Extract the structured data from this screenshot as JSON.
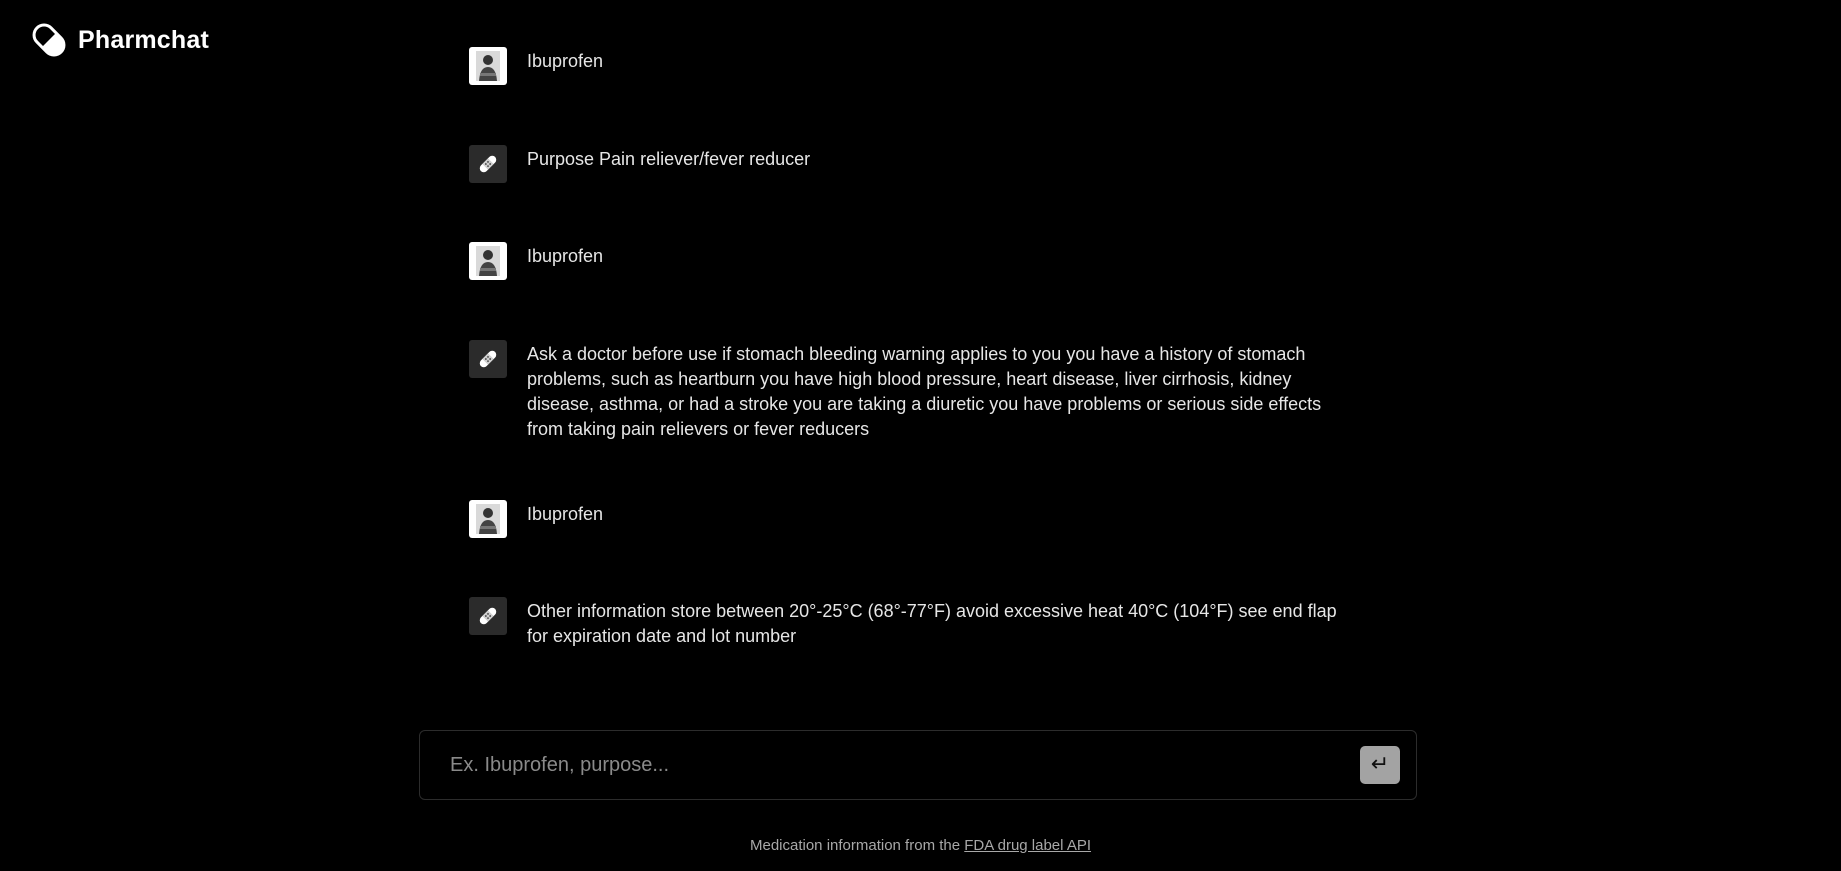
{
  "app": {
    "name": "Pharmchat",
    "logo_icon": "pill-icon"
  },
  "messages": [
    {
      "role": "user",
      "icon": "user-avatar",
      "text": "Ibuprofen"
    },
    {
      "role": "assistant",
      "icon": "bandage-icon",
      "text": "Purpose Pain reliever/fever reducer"
    },
    {
      "role": "user",
      "icon": "user-avatar",
      "text": "Ibuprofen"
    },
    {
      "role": "assistant",
      "icon": "bandage-icon",
      "text": "Ask a doctor before use if stomach bleeding warning applies to you you have a history of stomach problems, such as heartburn you have high blood pressure, heart disease, liver cirrhosis, kidney disease, asthma, or had a stroke you are taking a diuretic you have problems or serious side effects from taking pain relievers or fever reducers"
    },
    {
      "role": "user",
      "icon": "user-avatar",
      "text": "Ibuprofen"
    },
    {
      "role": "assistant",
      "icon": "bandage-icon",
      "text": "Other information store between 20°-25°C (68°-77°F) avoid excessive heat 40°C (104°F) see end flap for expiration date and lot number"
    }
  ],
  "composer": {
    "placeholder": "Ex. Ibuprofen, purpose...",
    "value": "",
    "send_icon": "enter-icon",
    "send_glyph": "↵"
  },
  "footer": {
    "prefix": "Medication information from the",
    "link_text": "FDA drug label API"
  },
  "colors": {
    "background": "#000000",
    "text": "#e6e6e6",
    "muted": "#a8a8a8",
    "bot_avatar_bg": "#2b2b2b",
    "send_button_bg": "#a3a3a3"
  }
}
